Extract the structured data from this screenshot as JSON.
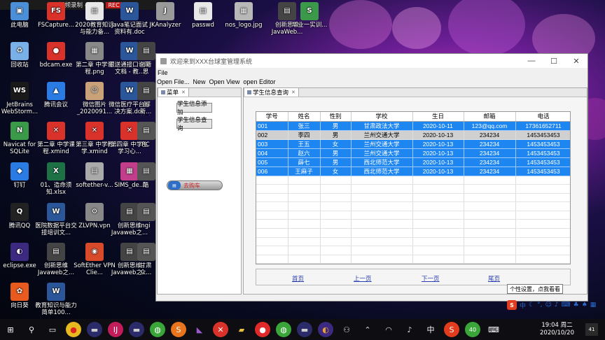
{
  "recorder": {
    "title": "视频录制 - 开始",
    "rec_label": "REC"
  },
  "desktop_icons": [
    {
      "label": "此电脑",
      "color": "#4a8fd8",
      "glyph": "▣"
    },
    {
      "label": "FSCapture...",
      "color": "#d8322a",
      "glyph": "FS"
    },
    {
      "label": "2020教育知识与能力备...",
      "color": "#e8e8e8",
      "glyph": "▤"
    },
    {
      "label": "java笔记面试资料有.doc",
      "color": "#2b579a",
      "glyph": "W"
    },
    {
      "label": "JKAnalyzer",
      "color": "#9a9a9a",
      "glyph": "J"
    },
    {
      "label": "passwd",
      "color": "#e8e8e8",
      "glyph": "▤"
    },
    {
      "label": "nos_logo.jpg",
      "color": "#b8b8b8",
      "glyph": "▦"
    },
    {
      "label": "创新思维JavaWeb...",
      "color": "#444",
      "glyph": "▤"
    },
    {
      "label": "毕业一实训...",
      "color": "#3a9a4a",
      "glyph": "S"
    },
    {
      "label": "回收站",
      "color": "#7ab0e8",
      "glyph": "♻"
    },
    {
      "label": "bdcam.exe",
      "color": "#d8322a",
      "glyph": "●"
    },
    {
      "label": "第二章 中学课程.png",
      "color": "#888",
      "glyph": "▦"
    },
    {
      "label": "银送通接口说明文档 - 教...",
      "color": "#2b579a",
      "glyph": "W"
    },
    {
      "label": "创新思维...",
      "color": "#444",
      "glyph": "▤"
    },
    {
      "label": "JetBrains WebStorm...",
      "color": "#1a1a1a",
      "glyph": "WS"
    },
    {
      "label": "腾讯会议",
      "color": "#2a7be4",
      "glyph": "▲"
    },
    {
      "label": "微信图片_2020091...",
      "color": "#c9a27a",
      "glyph": "☺"
    },
    {
      "label": "微信医疗平台解决方案.doc",
      "color": "#2b579a",
      "glyph": "W"
    },
    {
      "label": "创新...基础",
      "color": "#444",
      "glyph": "▤"
    },
    {
      "label": "Navicat for SQLite",
      "color": "#3a9a4a",
      "glyph": "N"
    },
    {
      "label": "第二章 中学课程.xmind",
      "color": "#d8322a",
      "glyph": "✕"
    },
    {
      "label": "第三章 中学教学.xmind",
      "color": "#d8322a",
      "glyph": "✕"
    },
    {
      "label": "第四章 中学生学习心...",
      "color": "#d8322a",
      "glyph": "✕"
    },
    {
      "label": "RC",
      "color": "#555",
      "glyph": "▤"
    },
    {
      "label": "钉钉",
      "color": "#2a7be4",
      "glyph": "◆"
    },
    {
      "label": "01、造命须知.xlsx",
      "color": "#1e7145",
      "glyph": "X"
    },
    {
      "label": "softether-v...",
      "color": "#aaa",
      "glyph": "▤"
    },
    {
      "label": "SIMS_de...",
      "color": "#c23d8a",
      "glyph": "▦"
    },
    {
      "label": "酷",
      "color": "#555",
      "glyph": "▤"
    },
    {
      "label": "腾讯QQ",
      "color": "#222",
      "glyph": "Q"
    },
    {
      "label": "医院数据平台交接培训文...",
      "color": "#2b579a",
      "glyph": "W"
    },
    {
      "label": "ZLVPN.vpn",
      "color": "#888",
      "glyph": "⚙"
    },
    {
      "label": "创新思维Javaweb之...",
      "color": "#444",
      "glyph": "▤"
    },
    {
      "label": "ngi",
      "color": "#555",
      "glyph": "▤"
    },
    {
      "label": "eclipse.exe",
      "color": "#3b2a80",
      "glyph": "◐"
    },
    {
      "label": "创新思维Javaweb之...",
      "color": "#444",
      "glyph": "▤"
    },
    {
      "label": "SoftEther VPN Clie...",
      "color": "#d84a2a",
      "glyph": "◉"
    },
    {
      "label": "创新思维Javaweb之...",
      "color": "#444",
      "glyph": "▤"
    },
    {
      "label": "甘肃众...",
      "color": "#555",
      "glyph": "▤"
    },
    {
      "label": "向日葵",
      "color": "#e85a1e",
      "glyph": "✿"
    },
    {
      "label": "教育知识与能力简单100...",
      "color": "#2b579a",
      "glyph": "W"
    }
  ],
  "window": {
    "title": "欢迎来到XXX台球室管理系统",
    "menu": [
      "File"
    ],
    "toolbar": [
      "Open File...",
      "New",
      "Open View",
      "open Editor"
    ],
    "left_tab": "菜单",
    "right_tab": "学生信息查询",
    "buttons": {
      "add": "学生信息添加",
      "query": "学生信息查询"
    },
    "cart_label": "去购车",
    "table": {
      "headers": [
        "学号",
        "姓名",
        "性别",
        "学校",
        "生日",
        "邮箱",
        "电话"
      ],
      "rows": [
        [
          "001",
          "张三",
          "男",
          "甘肃政法大学",
          "2020-10-11",
          "123@qq.com",
          "17361652711"
        ],
        [
          "002",
          "李四",
          "男",
          "兰州交通大学",
          "2020-10-13",
          "234234",
          "1453453453"
        ],
        [
          "003",
          "王五",
          "女",
          "兰州交通大学",
          "2020-10-13",
          "234234",
          "1453453453"
        ],
        [
          "004",
          "赵六",
          "男",
          "兰州交通大学",
          "2020-10-13",
          "234234",
          "1453453453"
        ],
        [
          "005",
          "薛七",
          "男",
          "西北师范大学",
          "2020-10-13",
          "234234",
          "1453453453"
        ],
        [
          "006",
          "王麻子",
          "女",
          "西北师范大学",
          "2020-10-13",
          "234234",
          "1453453453"
        ]
      ]
    },
    "pager": {
      "first": "首页",
      "prev": "上一页",
      "next": "下一页",
      "last": "尾页"
    }
  },
  "tooltip": "个性设置，点我看看",
  "ime": {
    "lang": "中"
  },
  "taskbar": {
    "clock_time": "19:04 周二",
    "clock_date": "2020/10/20",
    "lang": "中",
    "notification_count": "41"
  }
}
